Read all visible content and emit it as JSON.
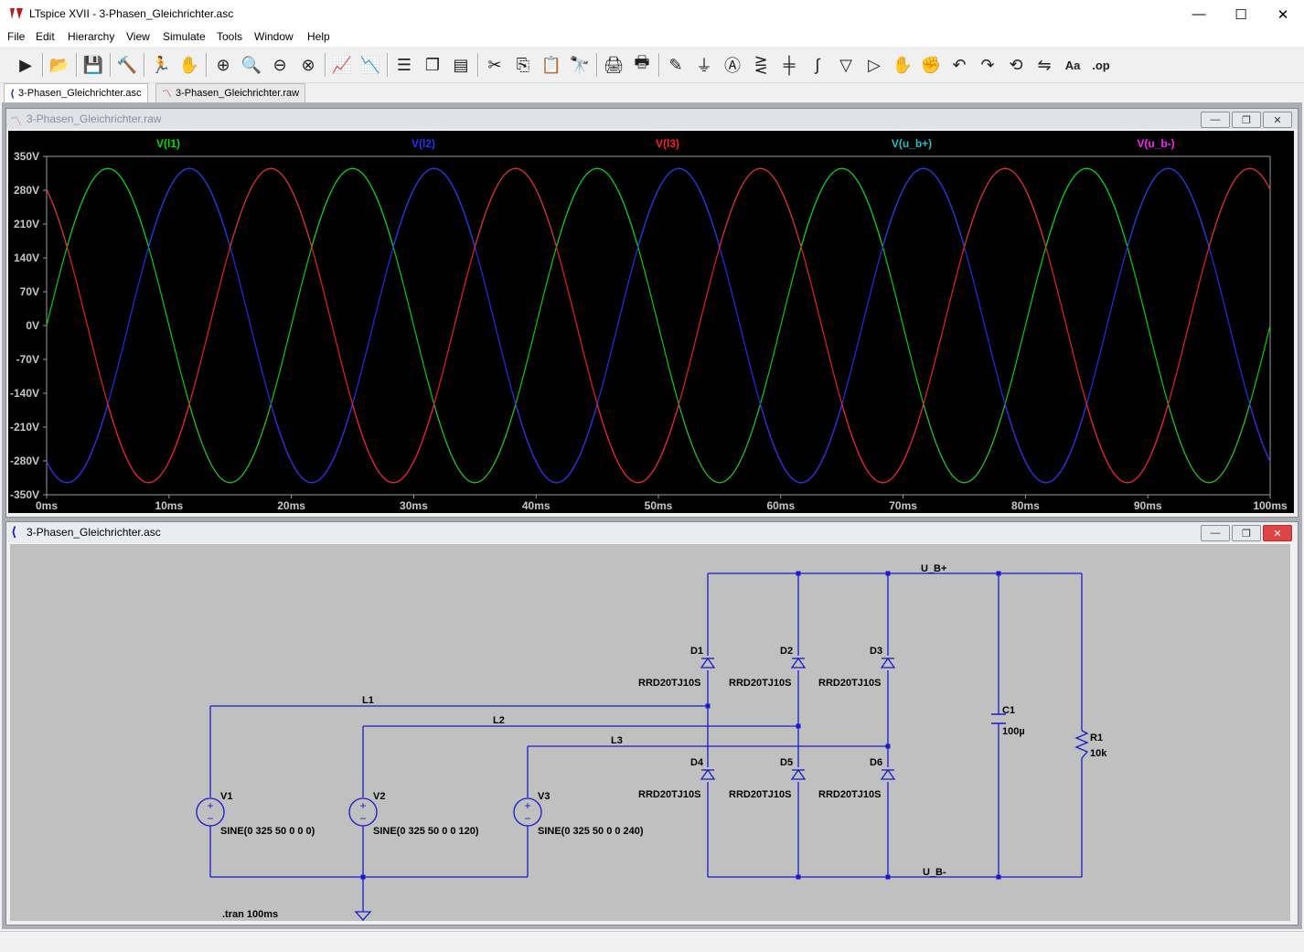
{
  "app": {
    "title": "LTspice XVII - 3-Phasen_Gleichrichter.asc"
  },
  "window_controls": {
    "minimize": "—",
    "maximize": "☐",
    "close": "✕"
  },
  "menu": [
    "File",
    "Edit",
    "Hierarchy",
    "View",
    "Simulate",
    "Tools",
    "Window",
    "Help"
  ],
  "toolbar": {
    "icons": [
      "run-icon",
      "open-icon",
      "save-icon",
      "control-panel-icon",
      "halt-icon",
      "pan-icon",
      "zoom-in-icon",
      "zoom-fit-icon",
      "zoom-out-icon",
      "zoom-cancel-icon",
      "autorange-icon",
      "plot-settings-icon",
      "tile-horizontal-icon",
      "cascade-icon",
      "tile-vertical-icon",
      "cut-icon",
      "copy-icon",
      "paste-icon",
      "find-icon",
      "print-icon",
      "print-setup-icon",
      "wire-icon",
      "ground-icon",
      "label-icon",
      "resistor-icon",
      "capacitor-icon",
      "inductor-icon",
      "diode-icon",
      "component-icon",
      "move-icon",
      "drag-icon",
      "undo-icon",
      "redo-icon",
      "rotate-icon",
      "mirror-icon",
      "text-icon",
      "spice-directive-icon"
    ],
    "glyphs": [
      "▶",
      "📂",
      "💾",
      "🔨",
      "🏃",
      "✋",
      "⊕",
      "🔍",
      "⊖",
      "⊗",
      "📈",
      "📉",
      "☰",
      "❐",
      "▤",
      "✂",
      "⎘",
      "📋",
      "🔭",
      "🖨",
      "🖶",
      "✎",
      "⏚",
      "Ⓐ",
      "⋛",
      "╪",
      "∫",
      "▽",
      "▷",
      "✋",
      "✊",
      "↶",
      "↷",
      "⟲",
      "⇋",
      "Aa",
      ".op"
    ]
  },
  "tabs": [
    {
      "label": "3-Phasen_Gleichrichter.asc",
      "active": true
    },
    {
      "label": "3-Phasen_Gleichrichter.raw",
      "active": false
    }
  ],
  "waveform_window": {
    "title": "3-Phasen_Gleichrichter.raw"
  },
  "schematic_window": {
    "title": "3-Phasen_Gleichrichter.asc"
  },
  "chart_data": {
    "type": "line",
    "title": "",
    "xlabel": "",
    "ylabel": "",
    "xlim": [
      0,
      100
    ],
    "x_unit": "ms",
    "ylim": [
      -350,
      350
    ],
    "y_unit": "V",
    "y_ticks": [
      "350V",
      "280V",
      "210V",
      "140V",
      "70V",
      "0V",
      "-70V",
      "-140V",
      "-210V",
      "-280V",
      "-350V"
    ],
    "x_ticks": [
      "0ms",
      "10ms",
      "20ms",
      "30ms",
      "40ms",
      "50ms",
      "60ms",
      "70ms",
      "80ms",
      "90ms",
      "100ms"
    ],
    "background": "#000000",
    "grid": false,
    "series": [
      {
        "name": "V(l1)",
        "color": "#00e000",
        "amplitude": 325,
        "freq_hz": 50,
        "phase_deg": 0
      },
      {
        "name": "V(l2)",
        "color": "#2233ff",
        "amplitude": 325,
        "freq_hz": 50,
        "phase_deg": 120
      },
      {
        "name": "V(l3)",
        "color": "#ff2020",
        "amplitude": 325,
        "freq_hz": 50,
        "phase_deg": 240
      },
      {
        "name": "V(u_b+)",
        "color": "#20c0c0",
        "kind": "max_of_phases"
      },
      {
        "name": "V(u_b-)",
        "color": "#ff20ff",
        "kind": "min_of_phases"
      }
    ]
  },
  "schematic": {
    "nets": {
      "ub_plus": "U_B+",
      "ub_minus": "U_B-",
      "l1": "L1",
      "l2": "L2",
      "l3": "L3"
    },
    "sources": [
      {
        "ref": "V1",
        "value": "SINE(0 325 50 0 0 0)"
      },
      {
        "ref": "V2",
        "value": "SINE(0 325 50 0 0 120)"
      },
      {
        "ref": "V3",
        "value": "SINE(0 325 50 0 0 240)"
      }
    ],
    "diodes": [
      {
        "ref": "D1",
        "model": "RRD20TJ10S"
      },
      {
        "ref": "D2",
        "model": "RRD20TJ10S"
      },
      {
        "ref": "D3",
        "model": "RRD20TJ10S"
      },
      {
        "ref": "D4",
        "model": "RRD20TJ10S"
      },
      {
        "ref": "D5",
        "model": "RRD20TJ10S"
      },
      {
        "ref": "D6",
        "model": "RRD20TJ10S"
      }
    ],
    "capacitor": {
      "ref": "C1",
      "value": "100µ"
    },
    "resistor": {
      "ref": "R1",
      "value": "10k"
    },
    "directive": ".tran 100ms",
    "wire_color": "#1a1acc"
  }
}
